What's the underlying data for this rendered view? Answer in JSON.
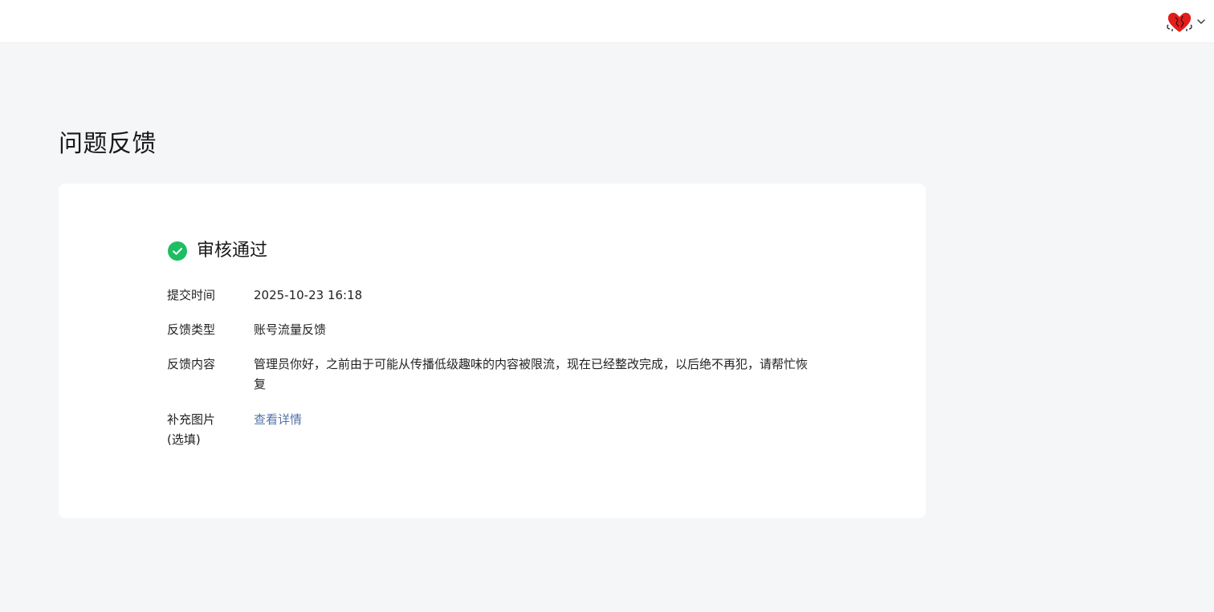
{
  "header": {
    "avatar_icon": "heart-avatar-icon",
    "dropdown_icon": "chevron-down-icon"
  },
  "page": {
    "title": "问题反馈"
  },
  "status": {
    "icon": "check-circle-icon",
    "text": "审核通过",
    "color": "#1dbd63"
  },
  "details": [
    {
      "label": "提交时间",
      "value": "2025-10-23 16:18"
    },
    {
      "label": "反馈类型",
      "value": "账号流量反馈"
    },
    {
      "label": "反馈内容",
      "value": "管理员你好，之前由于可能从传播低级趣味的内容被限流，现在已经整改完成，以后绝不再犯，请帮忙恢复"
    },
    {
      "label": "补充图片\n(选填)",
      "value": "查看详情"
    }
  ],
  "colors": {
    "link": "#5471a8",
    "background": "#f5f6f8",
    "card": "#ffffff"
  }
}
